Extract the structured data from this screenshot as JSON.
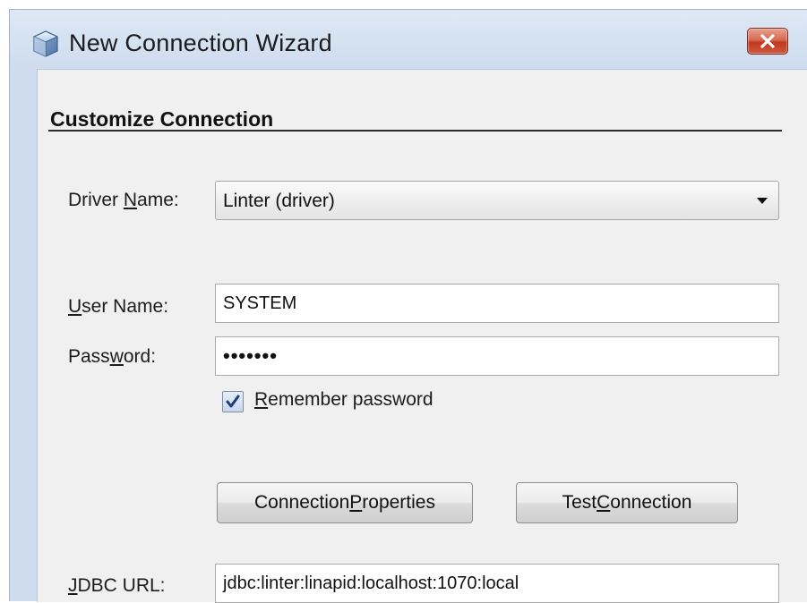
{
  "window": {
    "title": "New Connection Wizard"
  },
  "section": {
    "title": "Customize Connection"
  },
  "driver": {
    "label_prefix": "Driver ",
    "label_mnemonic": "N",
    "label_suffix": "ame:",
    "value": "Linter (driver)"
  },
  "user": {
    "label_mnemonic": "U",
    "label_suffix": "ser Name:",
    "value": "SYSTEM"
  },
  "password": {
    "label_prefix": "Pass",
    "label_mnemonic": "w",
    "label_suffix": "ord:",
    "masked_value": "•••••••"
  },
  "remember": {
    "checked": true,
    "label_mnemonic": "R",
    "label_suffix": "emember password"
  },
  "buttons": {
    "connection_properties_prefix": "Connection ",
    "connection_properties_mnemonic": "P",
    "connection_properties_suffix": "roperties",
    "test_connection_prefix": "Test ",
    "test_connection_mnemonic": "C",
    "test_connection_suffix": "onnection"
  },
  "jdbc": {
    "label_mnemonic": "J",
    "label_suffix": "DBC URL:",
    "value": "jdbc:linter:linapid:localhost:1070:local"
  },
  "colors": {
    "close_button": "#c0391f",
    "title_bar": "#d6e3f2",
    "dialog_body": "#f0f0f0"
  }
}
